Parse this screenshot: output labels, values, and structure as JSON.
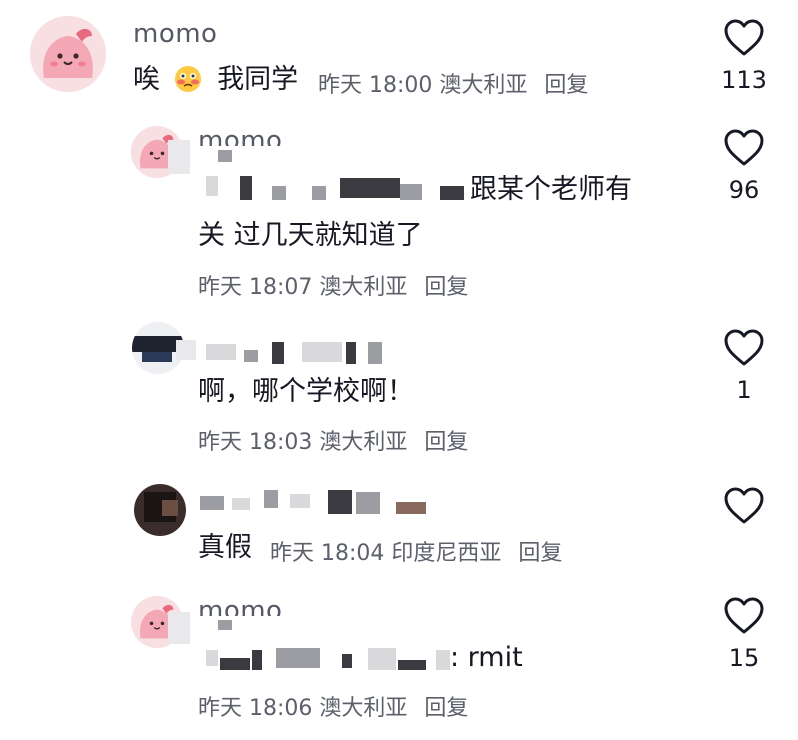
{
  "comments": [
    {
      "username": "momo",
      "text": "唉",
      "text2": "我同学",
      "time": "昨天 18:00",
      "location": "澳大利亚",
      "reply_label": "回复",
      "likes": "113"
    },
    {
      "username": "momo",
      "text_line1": "跟某个老师有",
      "text_line2": "关 过几天就知道了",
      "time": "昨天 18:07",
      "location": "澳大利亚",
      "reply_label": "回复",
      "likes": "96"
    },
    {
      "username": "",
      "text": "啊，哪个学校啊！",
      "time": "昨天 18:03",
      "location": "澳大利亚",
      "reply_label": "回复",
      "likes": "1"
    },
    {
      "username": "",
      "text": "真假",
      "time": "昨天 18:04",
      "location": "印度尼西亚",
      "reply_label": "回复",
      "likes": ""
    },
    {
      "username": "momo",
      "text": ": rmit",
      "time": "昨天 18:06",
      "location": "澳大利亚",
      "reply_label": "回复",
      "likes": "15"
    }
  ],
  "icons": {
    "like": "heart-outline-icon",
    "avatar_face": "pink-blob-avatar",
    "emoji": "flushed-face-emoji"
  },
  "colors": {
    "avatar_pink": "#f8dfe2",
    "text_primary": "#161823",
    "text_secondary": "#5c606b"
  }
}
